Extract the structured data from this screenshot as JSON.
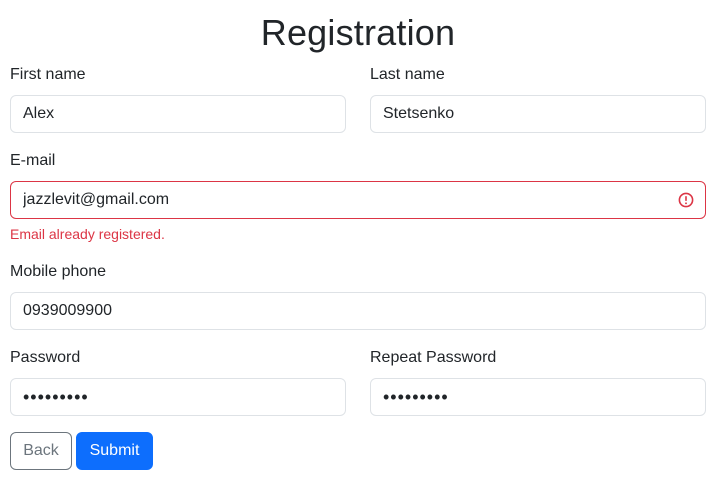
{
  "title": "Registration",
  "first_name": {
    "label": "First name",
    "value": "Alex"
  },
  "last_name": {
    "label": "Last name",
    "value": "Stetsenko"
  },
  "email": {
    "label": "E-mail",
    "value": "jazzlevit@gmail.com",
    "error": "Email already registered.",
    "error_icon": "exclamation-circle-icon",
    "error_color": "#dc3545"
  },
  "phone": {
    "label": "Mobile phone",
    "value": "0939009900"
  },
  "password": {
    "label": "Password",
    "value": "•••••••••"
  },
  "repeat_password": {
    "label": "Repeat Password",
    "value": "•••••••••"
  },
  "buttons": {
    "back_label": "Back",
    "submit_label": "Submit",
    "primary_color": "#0d6efd"
  }
}
